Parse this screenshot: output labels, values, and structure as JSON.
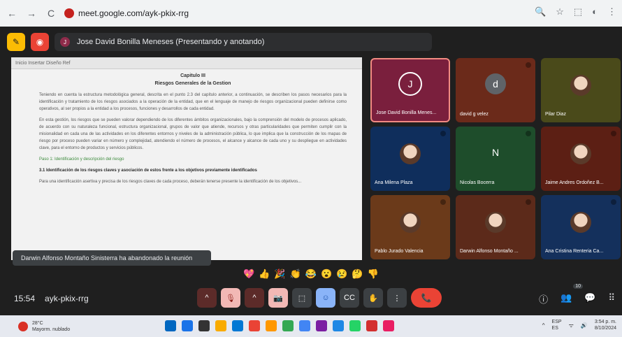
{
  "browser": {
    "url": "meet.google.com/ayk-pkix-rrg",
    "nav": {
      "back": "←",
      "forward": "→",
      "reload": "C"
    },
    "right_icons": [
      "🔍",
      "☆",
      "⬚",
      "◐",
      "⋮"
    ]
  },
  "meet": {
    "presenter_label": "Jose David Bonilla Meneses (Presentando y anotando)",
    "presenter_initial": "J",
    "document": {
      "toolbar_text": "Inicio   Insertar   Diseño   Ref",
      "chapter": "Capitulo III",
      "heading": "Riesgos Generales de la Gestion",
      "paragraphs": [
        "Teniendo en cuenta la estructura metodológica general, descrita en el punto 2.3 del capítulo anterior, a continuación, se describen los pasos necesarios para la identificación y tratamiento de los riesgos asociados a la operación de la entidad, que en el lenguaje de manejo de riesgos organizacional pueden definirse como operativos, al ser propios a la entidad a los procesos, funciones y desarrollos de cada entidad.",
        "En esta gestión, los riesgos que se pueden valorar dependiendo de los diferentes ámbitos organizacionales, bajo la comprensión del modelo de procesos aplicado, de acuerdo con su naturaleza funcional, estructura organizacional, grupos de valor que atiende, recursos y otras particularidades que permiten cumplir con la misionalidad en cada una de las actividades en los diferentes entornos y niveles de la administración pública, lo que implica que la construcción de los mapas de riesgo por proceso pueden variar en número y complejidad, atendiendo el número de procesos, el alcance y alcance de cada uno y su despliegue en actividades clave, para el entorno de productos y servicios públicos."
      ],
      "note": "Paso 1: Identificación y descripción del riesgo",
      "section": "3.1 Identificación de los riesgos claves y asociación de estos frente a los objetivos previamente identificados",
      "last_para": "Para una identificación asertiva y precisa de los riesgos claves de cada proceso, deberán tenerse presente la identificación de los objetivos..."
    },
    "toast": "Darwin Alfonso Montaño Sinisterra ha abandonado la reunión",
    "participants": [
      {
        "name": "Jose David Bonilla Menes...",
        "initial": "J",
        "color": "#7a1f3d"
      },
      {
        "name": "david g velez",
        "initial": "d",
        "color": "#6b2a1a"
      },
      {
        "name": "Pilar Diaz",
        "initial": "",
        "color": "#4a4a1a"
      },
      {
        "name": "Ana Milena Plaza",
        "initial": "",
        "color": "#0f2e5c"
      },
      {
        "name": "Nicolas Bocerra",
        "initial": "N",
        "color": "#1e4d2b"
      },
      {
        "name": "Jaime Andres Ordoñez B...",
        "initial": "",
        "color": "#5c1f14"
      },
      {
        "name": "Pablo Jurado Valencia",
        "initial": "",
        "color": "#6b3a1a"
      },
      {
        "name": "Darwin Alfonso Montaño ...",
        "initial": "",
        "color": "#5c2a1a"
      },
      {
        "name": "Ana Cristina Renteria Ca...",
        "initial": "",
        "color": "#14305c"
      }
    ],
    "reactions": [
      "💖",
      "👍",
      "🎉",
      "👏",
      "😂",
      "😮",
      "😢",
      "🤔",
      "👎"
    ],
    "time": "15:54",
    "meeting_code": "ayk-pkix-rrg",
    "participant_count": "10",
    "controls": {
      "mic_expand": "^",
      "mic": "🎙",
      "cam_expand": "^",
      "cam": "📷",
      "present": "⬚",
      "emoji": "☺",
      "captions": "CC",
      "raise_hand": "✋",
      "more": "⋮",
      "leave": "📞"
    },
    "right_controls": [
      "ⓘ",
      "👥",
      "💬",
      "⠿"
    ]
  },
  "taskbar": {
    "temp": "28°C",
    "weather_text": "Mayorm. nublado",
    "lang": "ESP",
    "lang_sub": "ES",
    "clock_time": "3:54 p. m.",
    "clock_date": "8/10/2024",
    "app_colors": [
      "#0067c0",
      "#1a73e8",
      "#333333",
      "#f9ab00",
      "#0078d4",
      "#ea4335",
      "#ff9800",
      "#34a853",
      "#4285f4",
      "#7b1fa2",
      "#1e88e5",
      "#25d366",
      "#d32f2f",
      "#e91e63"
    ]
  }
}
